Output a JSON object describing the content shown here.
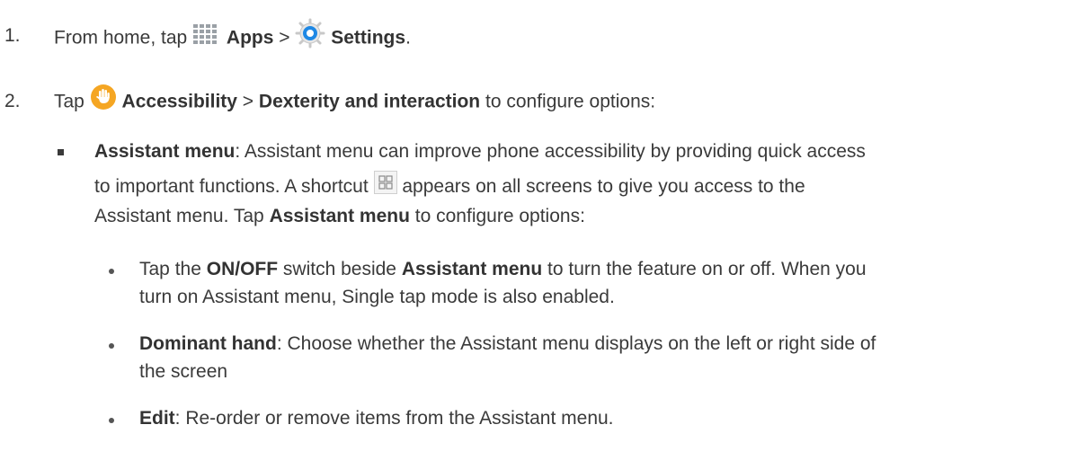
{
  "step1": {
    "number": "1.",
    "prefix": "From home, tap",
    "apps": "Apps",
    "sep": ">",
    "settings": "Settings",
    "end": "."
  },
  "step2": {
    "number": "2.",
    "prefix": "Tap",
    "accessibility": "Accessibility",
    "sep": ">",
    "dexterity": "Dexterity and interaction",
    "suffix": "to configure options:"
  },
  "assistant": {
    "title": "Assistant menu",
    "l1_rest": ": Assistant menu can improve phone accessibility by providing quick access",
    "l2_a": "to important functions. A shortcut",
    "l2_b": "appears on all screens to give you access to the",
    "l3_a": "Assistant menu. Tap",
    "l3_bold": "Assistant menu",
    "l3_b": "to configure options:"
  },
  "sub1": {
    "a": "Tap the",
    "onoff": "ON/OFF",
    "b": "switch beside",
    "menu": "Assistant menu",
    "c": "to turn the feature on or off. When you",
    "line2": "turn on Assistant menu, Single tap mode is also enabled."
  },
  "sub2": {
    "title": "Dominant hand",
    "rest": ": Choose whether the Assistant menu displays on the left or right side of",
    "line2": "the screen"
  },
  "sub3": {
    "title": "Edit",
    "rest": ": Re-order or remove items from the Assistant menu."
  },
  "colors": {
    "text": "#3a3a3a",
    "settings_icon_blue": "#1e88e5",
    "accessibility_icon_orange": "#f5a623"
  }
}
